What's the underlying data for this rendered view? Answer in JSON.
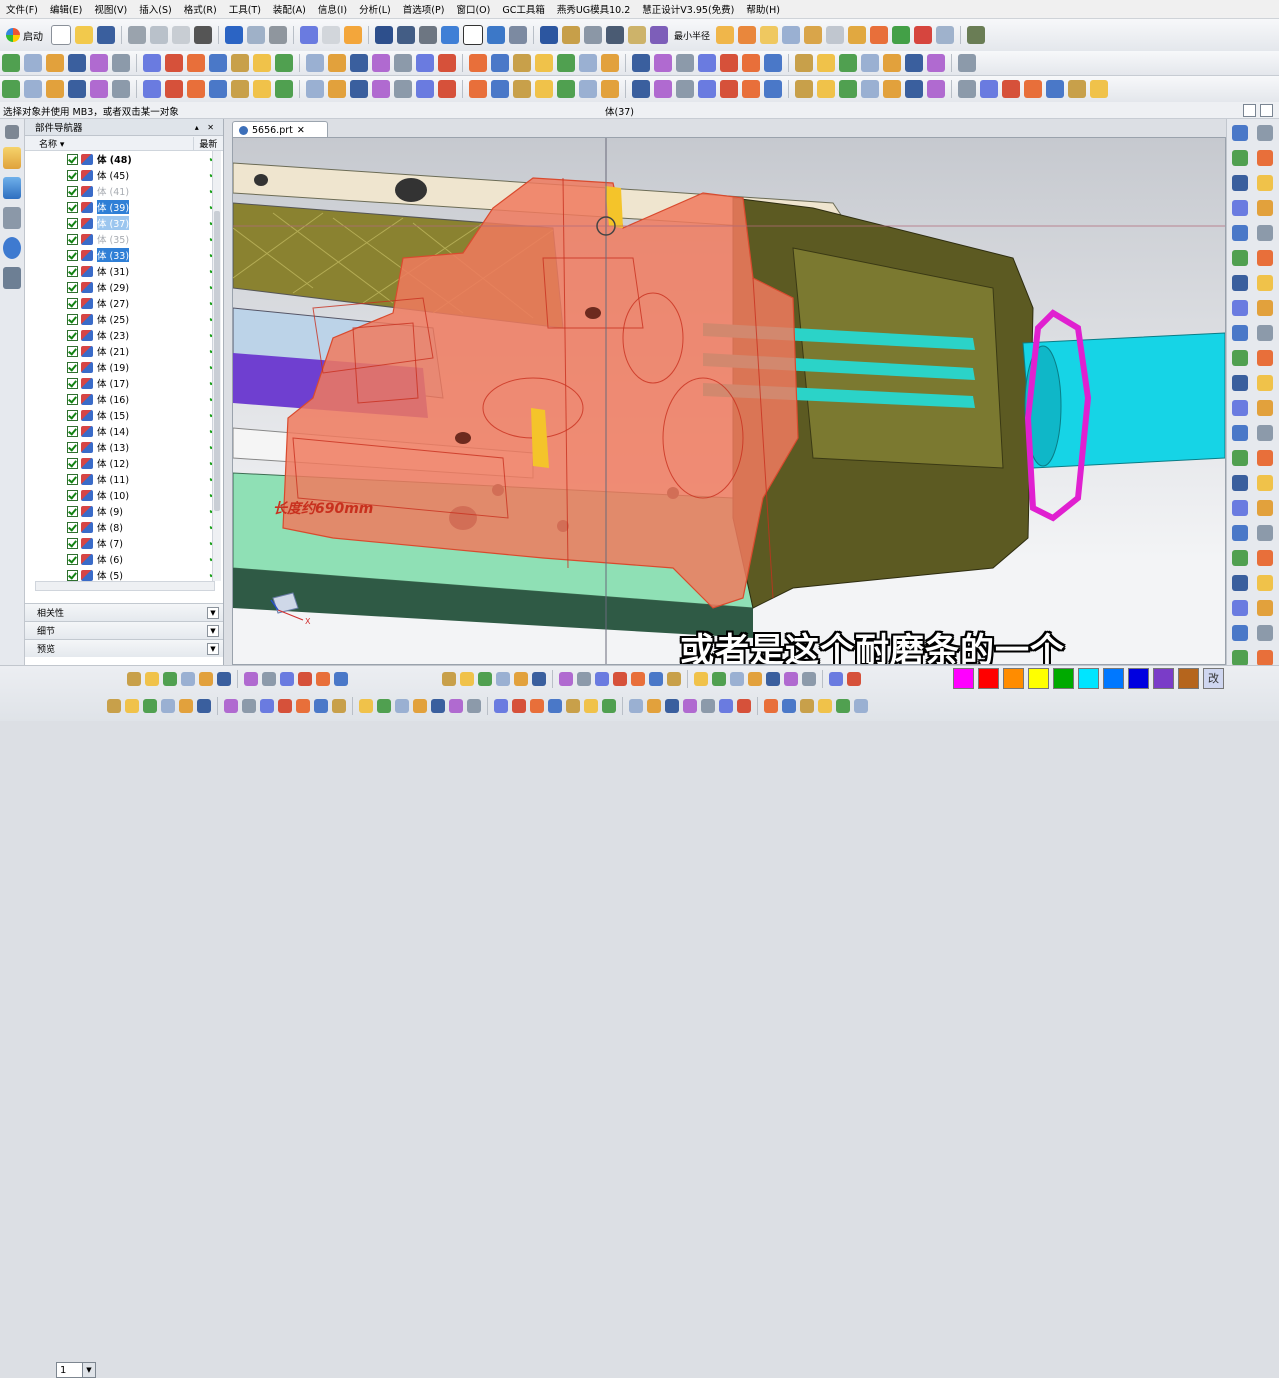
{
  "menu": [
    "文件(F)",
    "编辑(E)",
    "视图(V)",
    "插入(S)",
    "格式(R)",
    "工具(T)",
    "装配(A)",
    "信息(I)",
    "分析(L)",
    "首选项(P)",
    "窗口(O)",
    "GC工具箱",
    "燕秀UG模具10.2",
    "慧正设计V3.95(免费)",
    "帮助(H)"
  ],
  "toolbar": {
    "launch_label": "启动",
    "min_radius_label": "最小半径"
  },
  "status": {
    "prompt": "选择对象并使用 MB3，或者双击某一对象",
    "selection": "体(37)"
  },
  "navigator": {
    "title": "部件导航器",
    "col_name": "名称",
    "col_latest": "最新",
    "rows": [
      {
        "label": "体 (48)",
        "state": "bold"
      },
      {
        "label": "体 (45)",
        "state": "normal"
      },
      {
        "label": "体 (41)",
        "state": "grey"
      },
      {
        "label": "体 (39)",
        "state": "selected"
      },
      {
        "label": "体 (37)",
        "state": "selected-light"
      },
      {
        "label": "体 (35)",
        "state": "grey"
      },
      {
        "label": "体 (33)",
        "state": "selected"
      },
      {
        "label": "体 (31)",
        "state": "normal"
      },
      {
        "label": "体 (29)",
        "state": "normal"
      },
      {
        "label": "体 (27)",
        "state": "normal"
      },
      {
        "label": "体 (25)",
        "state": "normal"
      },
      {
        "label": "体 (23)",
        "state": "normal"
      },
      {
        "label": "体 (21)",
        "state": "normal"
      },
      {
        "label": "体 (19)",
        "state": "normal"
      },
      {
        "label": "体 (17)",
        "state": "normal"
      },
      {
        "label": "体 (16)",
        "state": "normal"
      },
      {
        "label": "体 (15)",
        "state": "normal"
      },
      {
        "label": "体 (14)",
        "state": "normal"
      },
      {
        "label": "体 (13)",
        "state": "normal"
      },
      {
        "label": "体 (12)",
        "state": "normal"
      },
      {
        "label": "体 (11)",
        "state": "normal"
      },
      {
        "label": "体 (10)",
        "state": "normal"
      },
      {
        "label": "体 (9)",
        "state": "normal"
      },
      {
        "label": "体 (8)",
        "state": "normal"
      },
      {
        "label": "体 (7)",
        "state": "normal"
      },
      {
        "label": "体 (6)",
        "state": "normal"
      },
      {
        "label": "体 (5)",
        "state": "normal"
      }
    ],
    "panels": [
      "相关性",
      "细节",
      "预览"
    ]
  },
  "document_tab": "5656.prt",
  "viewport": {
    "model_annotation": "长度约690mm",
    "triad_x": "X"
  },
  "subtitle": "或者是这个耐磨条的一个",
  "bottom": {
    "layer_value": "1",
    "colors": [
      "#ff00ff",
      "#ff0000",
      "#ff8c00",
      "#ffff00",
      "#00aa00",
      "#00e5ff",
      "#0078ff",
      "#0000e0",
      "#7a3cc8",
      "#b5651d"
    ],
    "more_colors_label": "改"
  },
  "colors": {
    "selection_blue": "#2f7fd6",
    "highlight_salmon": "#f07a5e"
  }
}
